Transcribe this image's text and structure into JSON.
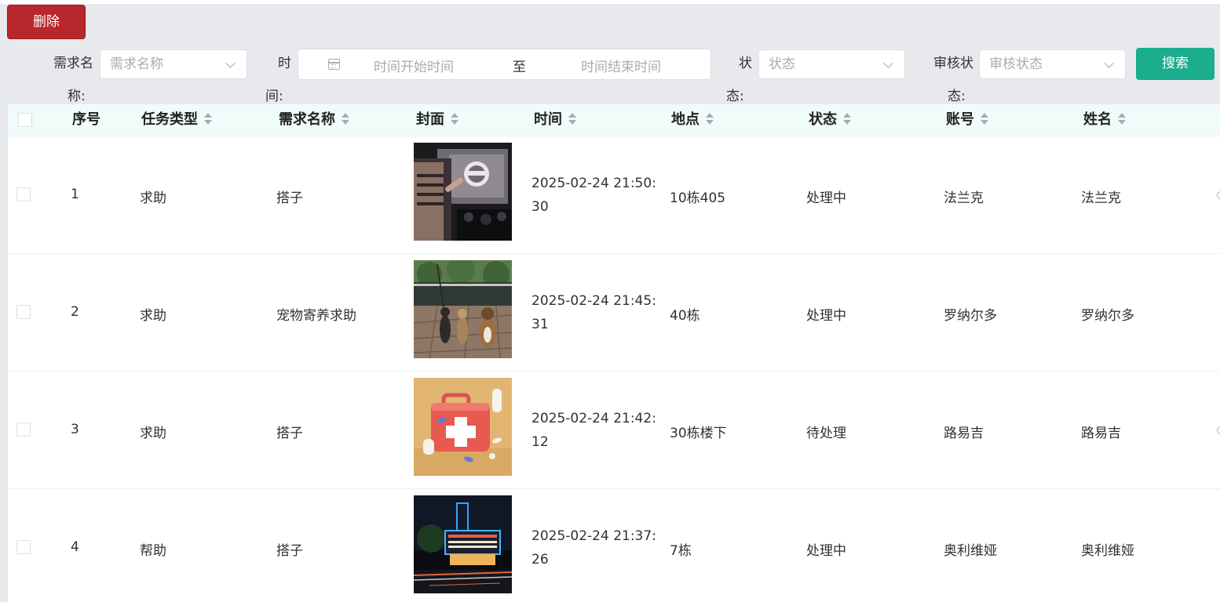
{
  "toolbar": {
    "delete_label": "删除",
    "search_label": "搜索"
  },
  "filters": {
    "name_label": "需求名称:",
    "name_label_line1": "需求名",
    "name_label_line2": "称:",
    "name_placeholder": "需求名称",
    "time_label_line1": "时",
    "time_label_line2": "间:",
    "time_start_placeholder": "时间开始时间",
    "time_separator": "至",
    "time_end_placeholder": "时间结束时间",
    "status_label_line1": "状",
    "status_label_line2": "态:",
    "status_placeholder": "状态",
    "audit_label_line1": "审核状",
    "audit_label_line2": "态:",
    "audit_placeholder": "审核状态"
  },
  "table": {
    "columns": [
      "序号",
      "任务类型",
      "需求名称",
      "封面",
      "时间",
      "地点",
      "状态",
      "账号",
      "姓名"
    ],
    "rows": [
      {
        "no": "1",
        "type": "求助",
        "name": "搭子",
        "cover": "presentation-photo",
        "time": "2025-02-24 21:50:30",
        "place": "10栋405",
        "status": "处理中",
        "account": "法兰克",
        "person": "法兰克"
      },
      {
        "no": "2",
        "type": "求助",
        "name": "宠物寄养求助",
        "cover": "dogs-photo",
        "time": "2025-02-24 21:45:31",
        "place": "40栋",
        "status": "处理中",
        "account": "罗纳尔多",
        "person": "罗纳尔多"
      },
      {
        "no": "3",
        "type": "求助",
        "name": "搭子",
        "cover": "first-aid-kit-photo",
        "time": "2025-02-24 21:42:12",
        "place": "30栋楼下",
        "status": "待处理",
        "account": "路易吉",
        "person": "路易吉"
      },
      {
        "no": "4",
        "type": "帮助",
        "name": "搭子",
        "cover": "theater-night-photo",
        "time": "2025-02-24 21:37:26",
        "place": "7栋",
        "status": "处理中",
        "account": "奥利维娅",
        "person": "奥利维娅"
      }
    ]
  },
  "colors": {
    "delete": "#b8272c",
    "search": "#1aad8e",
    "header_bg": "#effcfa",
    "page_bg": "#e7e9ec"
  }
}
